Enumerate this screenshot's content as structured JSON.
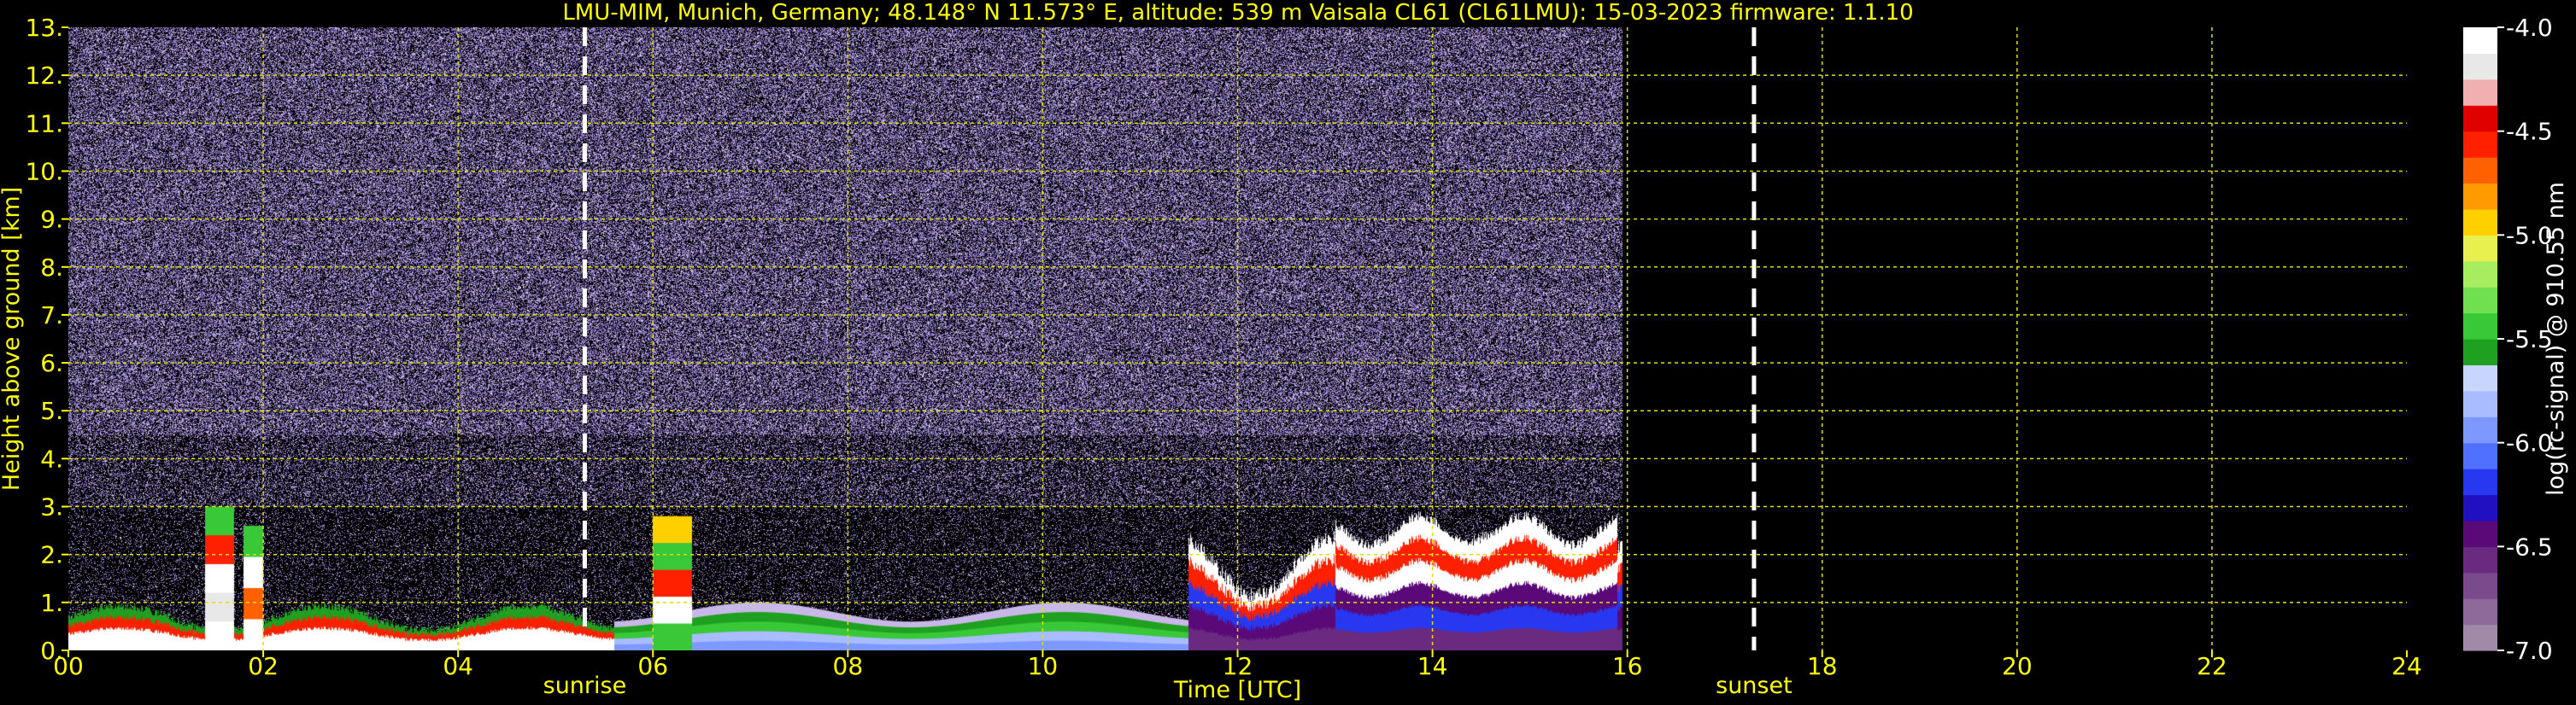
{
  "chart_data": {
    "type": "heatmap",
    "title": "LMU-MIM, Munich, Germany; 48.148° N 11.573° E, altitude: 539 m    Vaisala CL61 (CL61LMU): 15-03-2023    firmware: 1.1.10",
    "xlabel": "Time [UTC]",
    "ylabel": "Height above ground [km]",
    "xlim": [
      0,
      24
    ],
    "ylim": [
      0,
      13
    ],
    "x_ticks": [
      "00",
      "02",
      "04",
      "06",
      "08",
      "10",
      "12",
      "14",
      "16",
      "18",
      "20",
      "22",
      "24"
    ],
    "x_tick_values": [
      0,
      2,
      4,
      6,
      8,
      10,
      12,
      14,
      16,
      18,
      20,
      22,
      24
    ],
    "y_ticks": [
      "0.",
      "1.",
      "2.",
      "3.",
      "4.",
      "5.",
      "6.",
      "7.",
      "8.",
      "9.",
      "10.",
      "11.",
      "12.",
      "13."
    ],
    "y_tick_values": [
      0,
      1,
      2,
      3,
      4,
      5,
      6,
      7,
      8,
      9,
      10,
      11,
      12,
      13
    ],
    "grid": true,
    "grid_color": "#e0e000",
    "data_end_hour": 15.95,
    "annotations": [
      {
        "label": "sunrise",
        "x": 5.3
      },
      {
        "label": "sunset",
        "x": 17.3
      }
    ],
    "colorbar": {
      "label": "log(rc-signal) @ 910.55 nm",
      "range": [
        -7.0,
        -4.0
      ],
      "ticks": [
        "-4.0",
        "-4.5",
        "-5.0",
        "-5.5",
        "-6.0",
        "-6.5",
        "-7.0"
      ],
      "tick_values": [
        -4.0,
        -4.5,
        -5.0,
        -5.5,
        -6.0,
        -6.5,
        -7.0
      ],
      "colors": [
        "#a08aa8",
        "#8e6a9a",
        "#7b4a8c",
        "#6a2a80",
        "#5a0a78",
        "#2010c0",
        "#2838f0",
        "#5070ff",
        "#7d98ff",
        "#a8bcff",
        "#c8d6ff",
        "#20a020",
        "#38c838",
        "#70e050",
        "#a8ec60",
        "#e8f050",
        "#ffd000",
        "#ff9a00",
        "#ff6000",
        "#ff2000",
        "#e00000",
        "#f0b0b0",
        "#e8e8e8",
        "#ffffff"
      ]
    },
    "layers": [
      {
        "name": "noise",
        "y_range": [
          0,
          13
        ]
      },
      {
        "name": "boundary-layer-morning",
        "x_range": [
          0,
          5.6
        ],
        "y_range": [
          0,
          1.0
        ]
      },
      {
        "name": "boundary-layer-day",
        "x_range": [
          5.6,
          15.95
        ],
        "y_range": [
          0,
          3.0
        ]
      }
    ]
  }
}
